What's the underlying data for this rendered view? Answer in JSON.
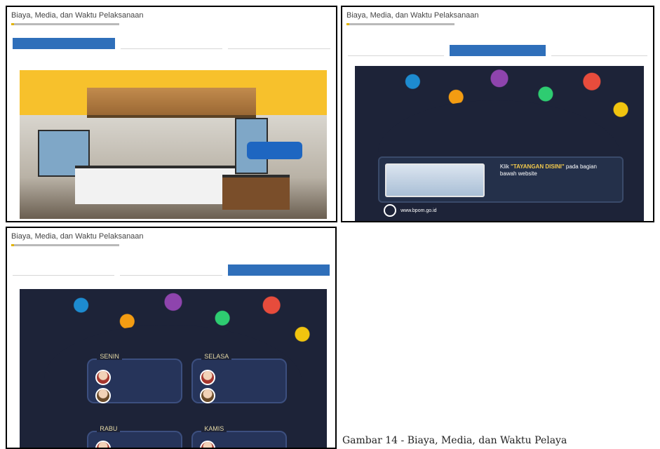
{
  "page": {
    "caption": "Gambar 14 - Biaya, Media, dan Waktu Pelaya"
  },
  "screens": [
    {
      "title": "Biaya, Media, dan Waktu Pelaksanaan",
      "subtitle": "",
      "tabs": [
        "",
        "",
        ""
      ],
      "active_tab": 0,
      "panel": {
        "type": "office-photo",
        "banner_text": ""
      }
    },
    {
      "title": "Biaya, Media, dan Waktu Pelaksanaan",
      "subtitle": "",
      "tabs": [
        "",
        "",
        ""
      ],
      "active_tab": 1,
      "panel": {
        "type": "media-info",
        "headline_prefix": "Klik",
        "headline_highlight": "\"TAYANGAN DISINI\"",
        "headline_suffix": "pada bagian",
        "headline_line2": "bawah website",
        "url": "www.bpom.go.id"
      }
    },
    {
      "title": "Biaya, Media, dan Waktu Pelaksanaan",
      "subtitle": "",
      "tabs": [
        "",
        "",
        ""
      ],
      "active_tab": 2,
      "panel": {
        "type": "schedule",
        "blocks": [
          {
            "day": "SENIN",
            "people": [
              {
                "name": "",
                "title": ""
              },
              {
                "name": "",
                "title": ""
              }
            ]
          },
          {
            "day": "SELASA",
            "people": [
              {
                "name": "",
                "title": ""
              },
              {
                "name": "",
                "title": ""
              }
            ]
          },
          {
            "day": "RABU",
            "people": [
              {
                "name": "",
                "title": ""
              }
            ]
          },
          {
            "day": "KAMIS",
            "people": [
              {
                "name": "",
                "title": ""
              }
            ]
          }
        ]
      }
    }
  ]
}
